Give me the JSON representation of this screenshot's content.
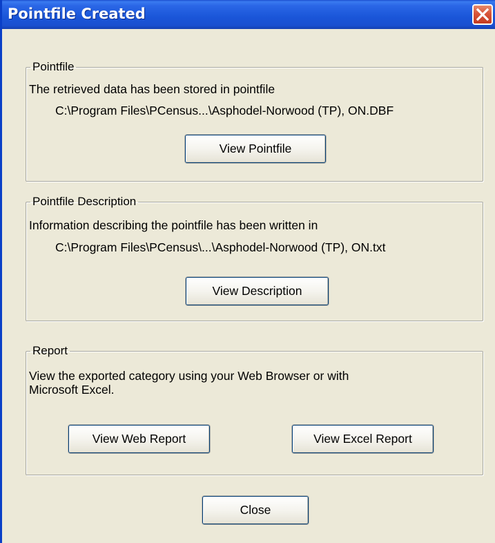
{
  "window": {
    "title": "Pointfile Created",
    "close_glyph": "close-icon"
  },
  "pointfile": {
    "legend": "Pointfile",
    "description": "The retrieved data has been stored in pointfile",
    "path": "C:\\Program Files\\PCensus...\\Asphodel-Norwood (TP), ON.DBF",
    "button_label": "View Pointfile"
  },
  "pointfile_description": {
    "legend": "Pointfile Description",
    "description": "Information describing the pointfile has been written in",
    "path": "C:\\Program Files\\PCensus\\...\\Asphodel-Norwood (TP), ON.txt",
    "button_label": "View Description"
  },
  "report": {
    "legend": "Report",
    "description_line1": "View the exported category using your Web Browser or with",
    "description_line2": "Microsoft Excel.",
    "web_button_label": "View Web Report",
    "excel_button_label": "View Excel Report"
  },
  "footer": {
    "close_label": "Close"
  },
  "colors": {
    "titlebar": "#2a66e6",
    "close_button": "#d8553a",
    "dialog_background": "#ece9d8"
  }
}
